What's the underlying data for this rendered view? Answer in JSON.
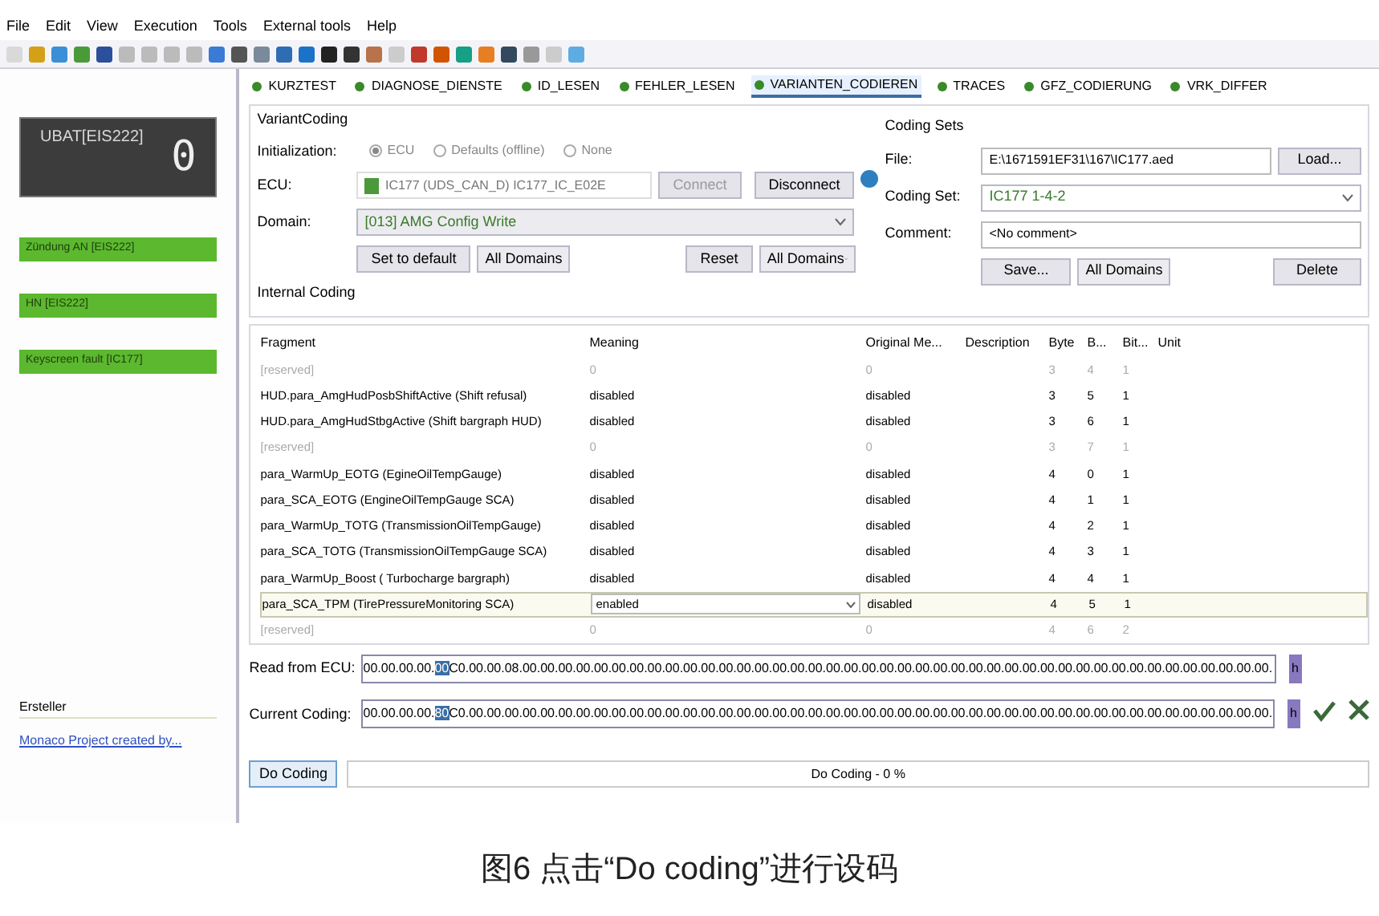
{
  "menu": [
    "File",
    "Edit",
    "View",
    "Execution",
    "Tools",
    "External tools",
    "Help"
  ],
  "left_panel": {
    "display": {
      "title": "UBAT[EIS222]",
      "digit": "0"
    },
    "status_bars": [
      {
        "label": "Zündung AN [EIS222]"
      },
      {
        "label": "HN [EIS222]"
      },
      {
        "label": "Keyscreen fault [IC177]"
      }
    ],
    "creator": {
      "heading": "Ersteller",
      "link": "Monaco Project created by..."
    }
  },
  "tabs": [
    {
      "label": "KURZTEST",
      "selected": false
    },
    {
      "label": "DIAGNOSE_DIENSTE",
      "selected": false
    },
    {
      "label": "ID_LESEN",
      "selected": false
    },
    {
      "label": "FEHLER_LESEN",
      "selected": false
    },
    {
      "label": "VARIANTEN_CODIEREN",
      "selected": true
    },
    {
      "label": "TRACES",
      "selected": false
    },
    {
      "label": "GFZ_CODIERUNG",
      "selected": false
    },
    {
      "label": "VRK_DIFFER",
      "selected": false
    }
  ],
  "variant_coding": {
    "title": "VariantCoding",
    "initialization_label": "Initialization:",
    "init_options": [
      {
        "label": "ECU",
        "selected": true
      },
      {
        "label": "Defaults (offline)",
        "selected": false
      },
      {
        "label": "None",
        "selected": false
      }
    ],
    "ecu_label": "ECU:",
    "ecu_value": "IC177 (UDS_CAN_D) IC177_IC_E02E",
    "connect": {
      "label": "Connect",
      "disabled": true
    },
    "disconnect": {
      "label": "Disconnect",
      "disabled": false
    },
    "domain_label": "Domain:",
    "domain_value": "[013] AMG Config Write",
    "set_default": "Set to default",
    "domains_select_1": "All Domains",
    "reset": "Reset",
    "domains_select_2": "All Domains"
  },
  "coding_sets": {
    "title": "Coding Sets",
    "file_label": "File:",
    "file_value": "E:\\1671591EF31\\167\\IC177.aed",
    "load": "Load...",
    "set_label": "Coding Set:",
    "set_value": "IC177 1-4-2",
    "comment_label": "Comment:",
    "comment_value": "<No comment>",
    "save": "Save...",
    "domains_select": "All Domains",
    "delete": "Delete"
  },
  "internal_coding": {
    "title": "Internal Coding",
    "columns": [
      "Fragment",
      "Meaning",
      "Original Me...",
      "Description",
      "Byte",
      "B...",
      "Bit...",
      "Unit"
    ],
    "rows": [
      {
        "fragment": "[reserved]",
        "meaning": "0",
        "original": "0",
        "byte": "3",
        "bit": "4",
        "bits": "1",
        "reserved": true,
        "selected": false
      },
      {
        "fragment": "HUD.para_AmgHudPosbShiftActive (Shift refusal)",
        "meaning": "disabled",
        "original": "disabled",
        "byte": "3",
        "bit": "5",
        "bits": "1",
        "reserved": false,
        "selected": false
      },
      {
        "fragment": "HUD.para_AmgHudStbgActive  (Shift bargraph HUD)",
        "meaning": "disabled",
        "original": "disabled",
        "byte": "3",
        "bit": "6",
        "bits": "1",
        "reserved": false,
        "selected": false
      },
      {
        "fragment": "[reserved]",
        "meaning": "0",
        "original": "0",
        "byte": "3",
        "bit": "7",
        "bits": "1",
        "reserved": true,
        "selected": false
      },
      {
        "fragment": "para_WarmUp_EOTG (EgineOilTempGauge)",
        "meaning": "disabled",
        "original": "disabled",
        "byte": "4",
        "bit": "0",
        "bits": "1",
        "reserved": false,
        "selected": false
      },
      {
        "fragment": "para_SCA_EOTG (EngineOilTempGauge SCA)",
        "meaning": "disabled",
        "original": "disabled",
        "byte": "4",
        "bit": "1",
        "bits": "1",
        "reserved": false,
        "selected": false
      },
      {
        "fragment": "para_WarmUp_TOTG (TransmissionOilTempGauge)",
        "meaning": "disabled",
        "original": "disabled",
        "byte": "4",
        "bit": "2",
        "bits": "1",
        "reserved": false,
        "selected": false
      },
      {
        "fragment": "para_SCA_TOTG (TransmissionOilTempGauge SCA)",
        "meaning": "disabled",
        "original": "disabled",
        "byte": "4",
        "bit": "3",
        "bits": "1",
        "reserved": false,
        "selected": false
      },
      {
        "fragment": "para_WarmUp_Boost ( Turbocharge bargraph)",
        "meaning": "disabled",
        "original": "disabled",
        "byte": "4",
        "bit": "4",
        "bits": "1",
        "reserved": false,
        "selected": false
      },
      {
        "fragment": "para_SCA_TPM (TirePressureMonitoring SCA)",
        "meaning": "enabled",
        "original": "disabled",
        "byte": "4",
        "bit": "5",
        "bits": "1",
        "reserved": false,
        "selected": true
      },
      {
        "fragment": "[reserved]",
        "meaning": "0",
        "original": "0",
        "byte": "4",
        "bit": "6",
        "bits": "2",
        "reserved": true,
        "selected": false
      }
    ]
  },
  "read_from_ecu": {
    "label": "Read from ECU:",
    "prefix": "00.00.00.00.",
    "highlight": "00",
    "suffix": "C0.00.00.08.00.00.00.00.00.00.00.00.00.00.00.00.00.00.00.00.00.00.00.00.00.00.00.00.00.00.00.00.00.00.00.00.00.00.00.00.00.00.00.00.00.00.",
    "unit": "h"
  },
  "current_coding": {
    "label": "Current Coding:",
    "prefix": "00.00.00.00.",
    "highlight": "80",
    "suffix": "C0.00.00.00.00.00.00.00.00.00.00.00.00.00.00.00.00.00.00.00.00.00.00.00.00.00.00.00.00.00.00.00.00.00.00.00.00.00.00.00.00.00.00.00.00.00.",
    "unit": "h"
  },
  "do_coding": {
    "button": "Do Coding",
    "progress_text": "Do Coding - 0 %",
    "level": 0
  },
  "caption": "图6 点击“Do coding”进行设码"
}
